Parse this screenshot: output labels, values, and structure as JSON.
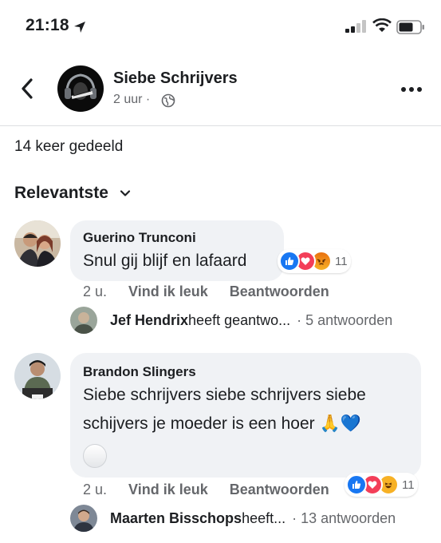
{
  "status_bar": {
    "time": "21:18"
  },
  "post": {
    "page_name": "Siebe Schrijvers",
    "time": "2 uur",
    "time_separator": "·"
  },
  "shares": "14 keer gedeeld",
  "sort": {
    "label": "Relevantste"
  },
  "comments": [
    {
      "author": "Guerino Trunconi",
      "text": "Snul gij blijf en lafaard",
      "reaction_count": "11",
      "time": "2 u.",
      "like_label": "Vind ik leuk",
      "reply_label": "Beantwoorden",
      "reply": {
        "name": "Jef Hendrix",
        "text": " heeft geantwo...",
        "count": "· 5 antwoorden"
      }
    },
    {
      "author": "Brandon Slingers",
      "text_line1": "Siebe schrijvers siebe schrijvers siebe",
      "text_line2": "schijvers je moeder is een hoer",
      "emoji_1": "🙏",
      "emoji_2": "💙",
      "reaction_count": "11",
      "time": "2 u.",
      "like_label": "Vind ik leuk",
      "reply_label": "Beantwoorden",
      "reply": {
        "name": "Maarten Bisschops",
        "text": " heeft...",
        "count": "· 13 antwoorden"
      }
    }
  ],
  "colors": {
    "like_blue": "#1877f2",
    "love_red": "#f33e58",
    "angry_orange": "#e9710f",
    "haha_yellow": "#f7b125",
    "bubble_bg": "#f0f2f5",
    "secondary_text": "#65676b"
  },
  "icons": {
    "back": "chevron-left-icon",
    "more": "more-dots-icon",
    "globe": "globe-icon",
    "sort": "chevron-down-icon"
  }
}
